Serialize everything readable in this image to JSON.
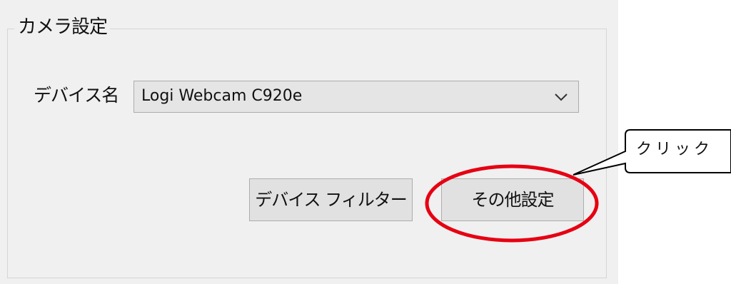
{
  "camera_settings": {
    "group_title": "カメラ設定",
    "device_label": "デバイス名",
    "device_select": {
      "selected_value": "Logi Webcam C920e",
      "arrow_icon": "chevron-down-icon"
    },
    "buttons": {
      "device_filter_label": "デバイス フィルター",
      "other_settings_label": "その他設定"
    }
  },
  "annotation": {
    "callout_text": "クリック",
    "highlight_color": "#e60012"
  }
}
